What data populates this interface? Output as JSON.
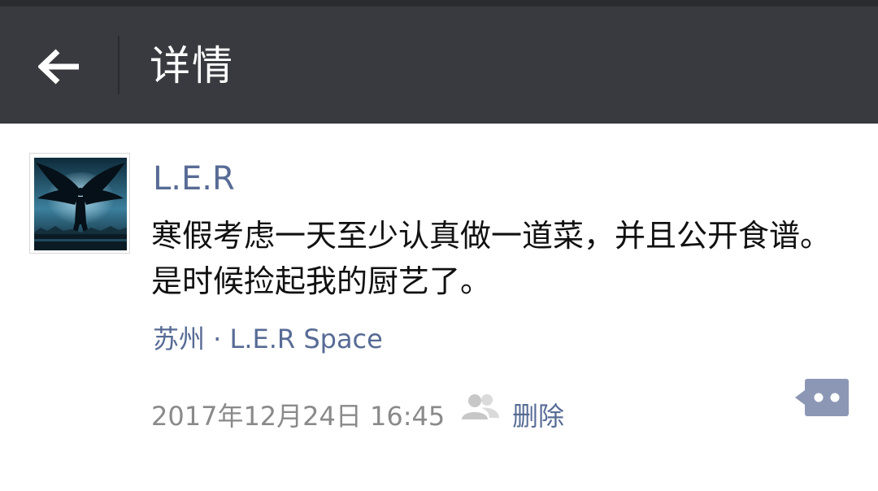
{
  "header": {
    "title": "详情",
    "back_icon": "arrow-left-icon"
  },
  "post": {
    "avatar_icon": "dark-angel-avatar",
    "username": "L.E.R",
    "content": "寒假考虑一天至少认真做一道菜，并且公开食谱。是时候捡起我的厨艺了。",
    "location": "苏州 · L.E.R Space",
    "timestamp": "2017年12月24日 16:45",
    "visibility_icon": "friends-icon",
    "delete_label": "删除",
    "more_icon": "comment-more-icon"
  },
  "colors": {
    "titlebar": "#393a3f",
    "link": "#576b95",
    "meta_text": "#8a8a8a"
  }
}
